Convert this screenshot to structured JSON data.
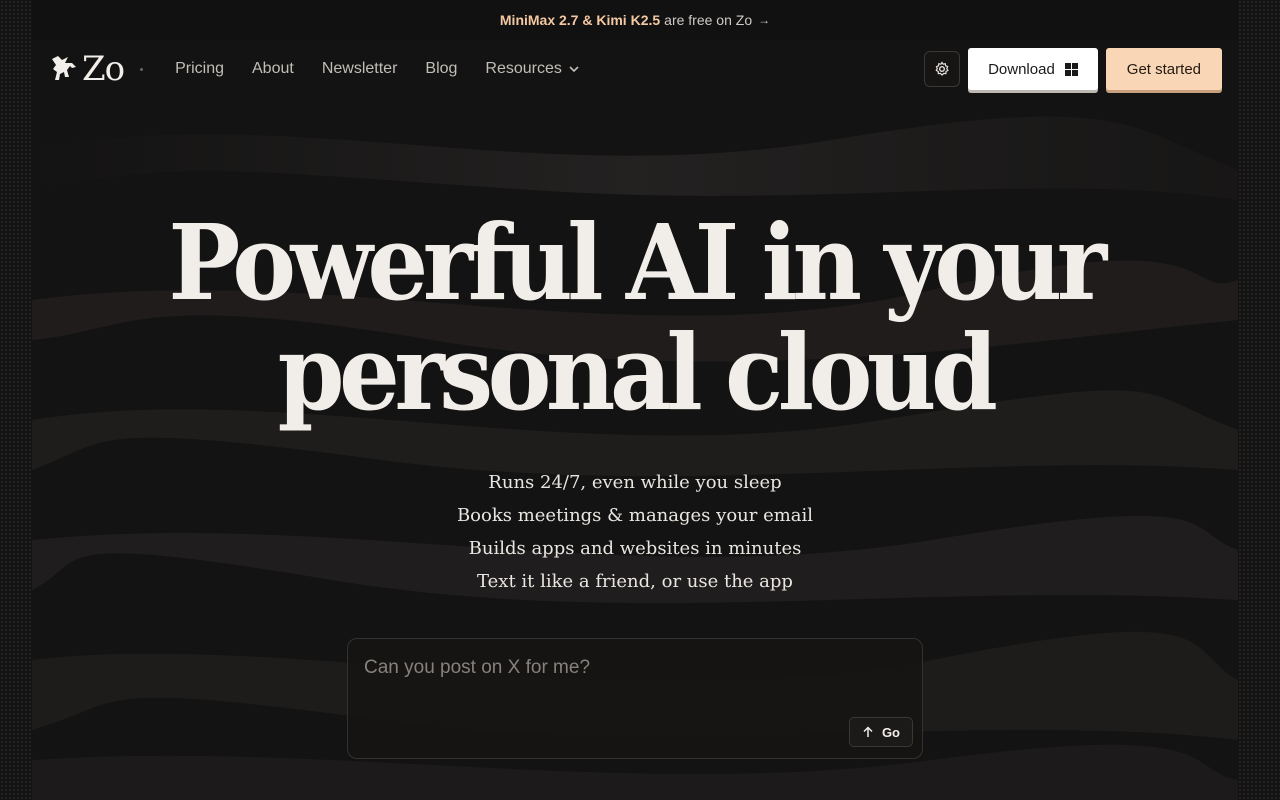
{
  "announcement": {
    "highlight": "MiniMax 2.7 & Kimi K2.5",
    "text": "are free on Zo",
    "arrow": "→"
  },
  "brand": {
    "name": "Zo"
  },
  "nav": {
    "links": [
      "Pricing",
      "About",
      "Newsletter",
      "Blog",
      "Resources"
    ]
  },
  "actions": {
    "download_label": "Download",
    "get_started_label": "Get started"
  },
  "hero": {
    "headline_line1": "Powerful AI  in your",
    "headline_line2": "personal cloud",
    "taglines": [
      "Runs 24/7, even while you sleep",
      "Books meetings & manages your email",
      "Builds apps and websites in minutes",
      "Text it like a friend, or use the app"
    ]
  },
  "prompt": {
    "placeholder": "Can you post on X for me?",
    "value": "",
    "go_label": "Go"
  },
  "colors": {
    "background": "#0f0e0e",
    "accent": "#f9d6b5",
    "highlight_text": "#f3c9a3"
  }
}
